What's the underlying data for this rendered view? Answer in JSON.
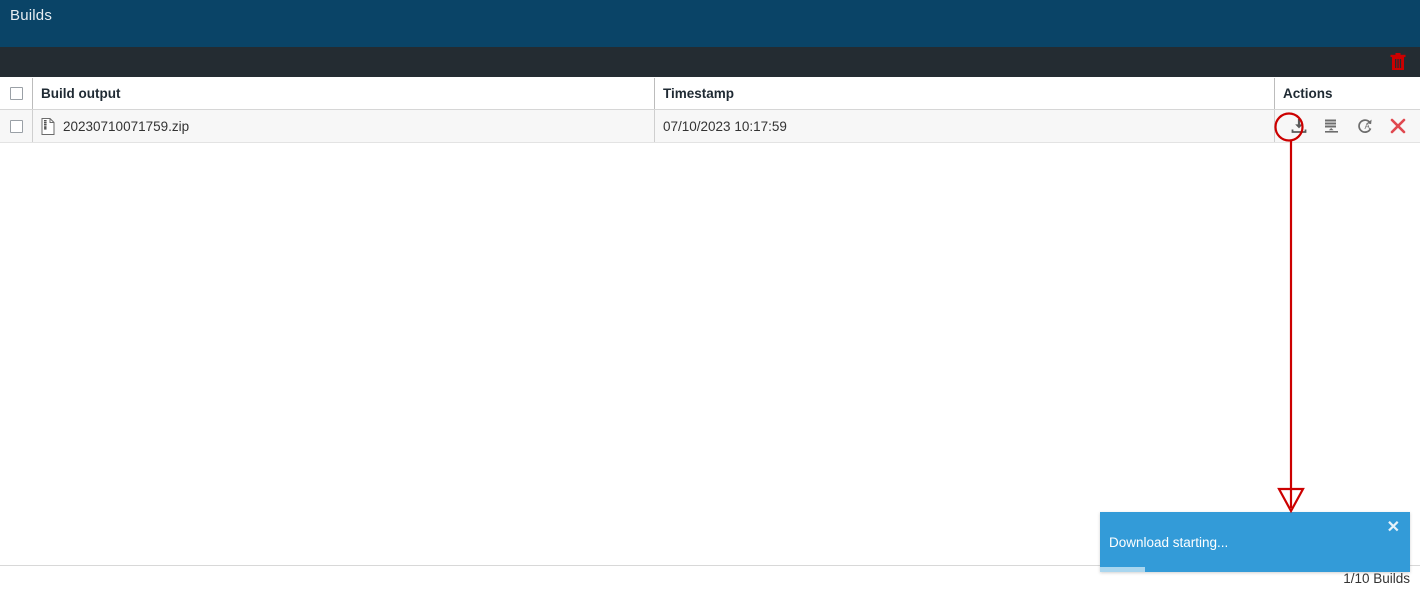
{
  "window": {
    "title": "Builds"
  },
  "toolbar": {
    "delete_icon": "trash-icon",
    "delete_color": "#cc0000"
  },
  "table": {
    "columns": [
      {
        "key": "select",
        "label": ""
      },
      {
        "key": "name",
        "label": "Build output"
      },
      {
        "key": "timestamp",
        "label": "Timestamp"
      },
      {
        "key": "actions",
        "label": "Actions"
      }
    ],
    "rows": [
      {
        "selected": false,
        "file_icon": "zip-file-icon",
        "name": "20230710071759.zip",
        "timestamp": "07/10/2023 10:17:59",
        "actions": [
          {
            "name": "download-icon",
            "title": "Download"
          },
          {
            "name": "move-to-folder-icon",
            "title": "Move"
          },
          {
            "name": "redeploy-icon",
            "title": "Redeploy"
          },
          {
            "name": "delete-icon",
            "title": "Delete"
          }
        ]
      }
    ]
  },
  "footer": {
    "count_text": "1/10 Builds"
  },
  "toast": {
    "message": "Download starting...",
    "close_label": "✕",
    "background": "#339bd8",
    "progress_percent": 15
  },
  "annotation": {
    "color": "#cc0000",
    "circle_target": "download-icon",
    "arrow_target": "toast"
  }
}
